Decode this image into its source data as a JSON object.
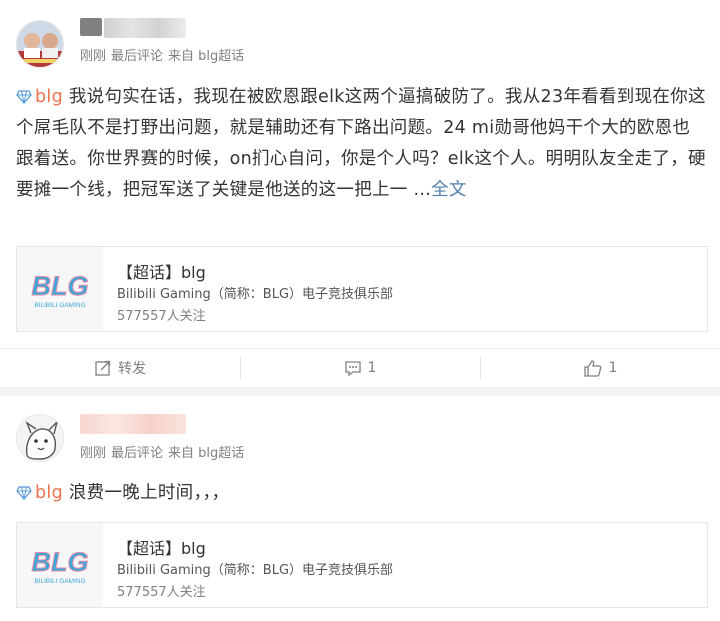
{
  "posts": [
    {
      "meta": {
        "time": "刚刚",
        "source_prefix": "最后评论",
        "source": "来自 blg超话"
      },
      "topic_tag": "blg",
      "text_body": "我说句实在话，我现在被欧恩跟elk这两个逼搞破防了。我从23年看看到现在你这个屌毛队不是打野出问题，就是辅助还有下路出问题。24 mi勋哥他妈干个大的欧恩也跟着送。你世界赛的时候，on扪心自问，你是个人吗？elk这个人。明明队友全走了，硬要摊一个线，把冠军送了关键是他送的这一把上一",
      "ellipsis": " ...",
      "more_label": "全文",
      "topic_card": {
        "title": "【超话】blg",
        "desc": "Bilibili Gaming（简称：BLG）电子竞技俱乐部",
        "follow": "577557人关注",
        "logo_text": "BLG",
        "logo_sub": "BILIBILI GAMING"
      },
      "actions": {
        "repost": "转发",
        "comment_count": "1",
        "like_count": "1"
      }
    },
    {
      "meta": {
        "time": "刚刚",
        "source_prefix": "最后评论",
        "source": "来自 blg超话"
      },
      "topic_tag": "blg",
      "text_body": "浪费一晚上时间，，，",
      "topic_card": {
        "title": "【超话】blg",
        "desc": "Bilibili Gaming（简称：BLG）电子竞技俱乐部",
        "follow": "577557人关注",
        "logo_text": "BLG",
        "logo_sub": "BILIBILI GAMING"
      }
    }
  ],
  "colors": {
    "accent": "#eb7350",
    "link": "#507daf",
    "logo_blue": "#3aa8d8",
    "logo_pink": "#e98aa7"
  }
}
